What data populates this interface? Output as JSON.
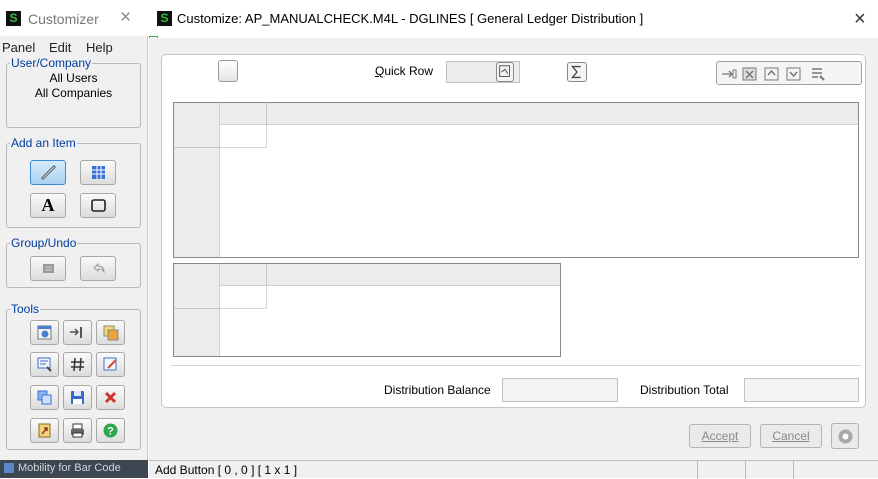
{
  "customizer": {
    "logo_letter": "S",
    "title": "Customizer",
    "close_glyph": "×",
    "menu": [
      "Panel",
      "Edit",
      "Help"
    ],
    "user_company": {
      "legend": "User/Company",
      "items": [
        "All Users",
        "All Companies"
      ]
    },
    "add_item": {
      "legend": "Add an Item",
      "text_button": "A"
    },
    "group_undo": {
      "legend": "Group/Undo"
    },
    "tools": {
      "legend": "Tools"
    },
    "taskbar_text": "Mobility for Bar Code"
  },
  "dialog": {
    "logo_letter": "S",
    "title": "Customize: AP_MANUALCHECK.M4L - DGLINES  [ General Ledger Distribution ]",
    "close_glyph": "×",
    "toolbar": {
      "quick_row_label": "Quick Row",
      "quick_row_value": ""
    },
    "distribution_balance_label": "Distribution Balance",
    "distribution_balance_value": "",
    "distribution_total_label": "Distribution Total",
    "distribution_total_value": "",
    "accept_label": "Accept",
    "cancel_label": "Cancel",
    "status_text": "Add Button  [ 0 , 0 ]  [ 1 x 1 ]"
  },
  "colors": {
    "accent_blue": "#003c9e",
    "logo_green": "#2fbf3f",
    "selection_blue": "#cde4f7"
  }
}
